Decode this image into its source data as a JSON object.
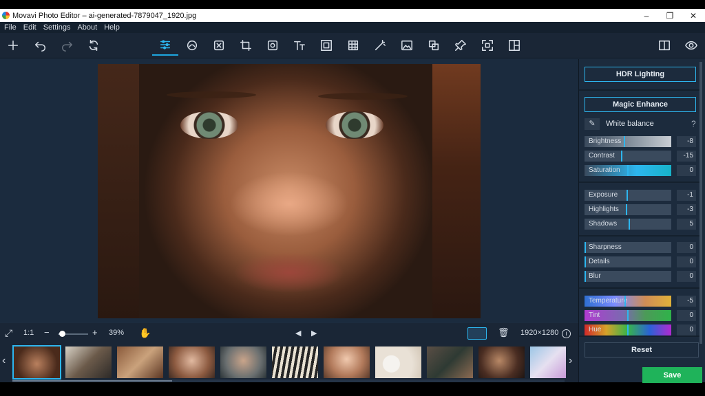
{
  "window": {
    "title": "Movavi Photo Editor – ai-generated-7879047_1920.jpg",
    "min": "–",
    "max": "❐",
    "close": "✕"
  },
  "menu": [
    "File",
    "Edit",
    "Settings",
    "About",
    "Help"
  ],
  "toolbar": {
    "left": [
      "add-icon",
      "undo-icon",
      "redo-icon",
      "rotate-icon"
    ],
    "center": [
      "adjust-icon",
      "retouch-icon",
      "ai-icon",
      "crop-icon",
      "object-remove-icon",
      "text-icon",
      "frame-icon",
      "background-icon",
      "magic-wand-icon",
      "image-icon",
      "replace-icon",
      "pin-icon",
      "resize-icon",
      "collage-icon"
    ],
    "right": [
      "compare-icon",
      "preview-icon"
    ]
  },
  "zoombar": {
    "fit": "⤢",
    "one_to_one": "1:1",
    "zoom_out": "−",
    "zoom_in": "+",
    "zoom_pct": "39%",
    "zoom_level": 0.1,
    "prev": "◀",
    "next": "▶",
    "dimensions": "1920×1280"
  },
  "panel": {
    "hdr_label": "HDR Lighting",
    "magic_label": "Magic Enhance",
    "white_balance_label": "White balance",
    "help": "?",
    "groups": [
      [
        {
          "label": "Brightness",
          "value": "-8",
          "level": 0.46
        },
        {
          "label": "Contrast",
          "value": "-15",
          "level": 0.43
        },
        {
          "label": "Saturation",
          "value": "0",
          "level": 0.5
        }
      ],
      [
        {
          "label": "Exposure",
          "value": "-1",
          "level": 0.49
        },
        {
          "label": "Highlights",
          "value": "-3",
          "level": 0.48
        },
        {
          "label": "Shadows",
          "value": "5",
          "level": 0.52
        }
      ],
      [
        {
          "label": "Sharpness",
          "value": "0",
          "level": 0.0
        },
        {
          "label": "Details",
          "value": "0",
          "level": 0.0
        },
        {
          "label": "Blur",
          "value": "0",
          "level": 0.0
        }
      ],
      [
        {
          "label": "Temperature",
          "value": "-5",
          "level": 0.47
        },
        {
          "label": "Tint",
          "value": "0",
          "level": 0.5
        },
        {
          "label": "Hue",
          "value": "0",
          "level": 0.5
        }
      ]
    ],
    "reset_label": "Reset",
    "save_label": "Save"
  },
  "colors": {
    "accent": "#2db6ef",
    "save": "#1fb35a"
  }
}
